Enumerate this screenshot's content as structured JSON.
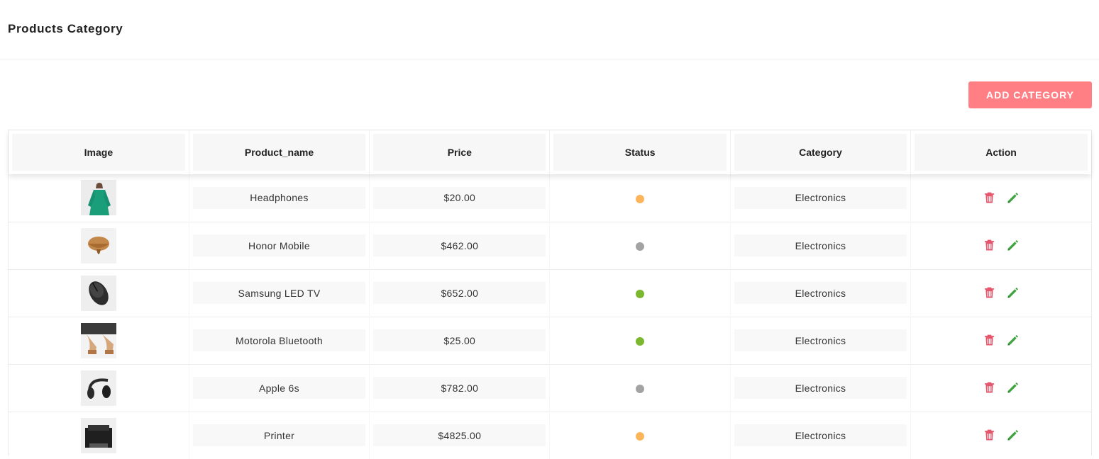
{
  "header": {
    "title": "Products Category"
  },
  "toolbar": {
    "add_label": "ADD CATEGORY"
  },
  "table": {
    "columns": [
      "Image",
      "Product_name",
      "Price",
      "Status",
      "Category",
      "Action"
    ],
    "rows": [
      {
        "image": "green-dress",
        "name": "Headphones",
        "price": "$20.00",
        "status_color": "#fdb55b",
        "category": "Electronics"
      },
      {
        "image": "straw-hat",
        "name": "Honor Mobile",
        "price": "$462.00",
        "status_color": "#a3a3a3",
        "category": "Electronics"
      },
      {
        "image": "computer-mouse",
        "name": "Samsung LED TV",
        "price": "$652.00",
        "status_color": "#7cb82f",
        "category": "Electronics"
      },
      {
        "image": "sandals",
        "name": "Motorola Bluetooth",
        "price": "$25.00",
        "status_color": "#7cb82f",
        "category": "Electronics"
      },
      {
        "image": "headphones",
        "name": "Apple 6s",
        "price": "$782.00",
        "status_color": "#a3a3a3",
        "category": "Electronics"
      },
      {
        "image": "printer",
        "name": "Printer",
        "price": "$4825.00",
        "status_color": "#fdb55b",
        "category": "Electronics"
      }
    ]
  },
  "icons": {
    "delete": "trash-icon",
    "edit": "pencil-icon"
  },
  "colors": {
    "accent": "#ff7f84",
    "delete": "#e5566d",
    "edit": "#3fa33f"
  }
}
